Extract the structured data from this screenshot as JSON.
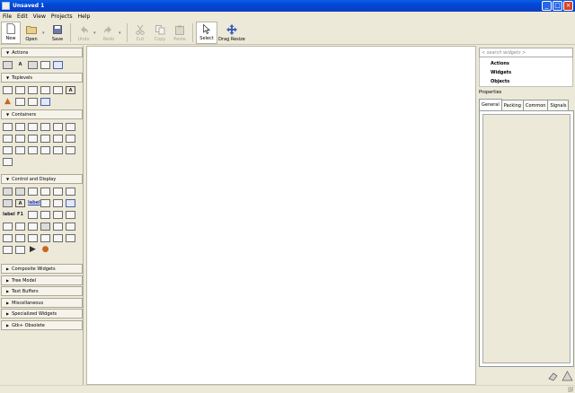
{
  "window": {
    "title": "Unsaved 1"
  },
  "menu": [
    "File",
    "Edit",
    "View",
    "Projects",
    "Help"
  ],
  "toolbar": {
    "new": "New",
    "open": "Open",
    "save": "Save",
    "undo": "Undo",
    "redo": "Redo",
    "cut": "Cut",
    "copy": "Copy",
    "paste": "Paste",
    "select": "Select",
    "drag_resize": "Drag Resize"
  },
  "palette": {
    "sections": {
      "actions": "Actions",
      "toplevels": "Toplevels",
      "containers": "Containers",
      "control": "Control and Display",
      "composite": "Composite Widgets",
      "tree": "Tree Model",
      "text": "Text Buffers",
      "misc": "Miscellaneous",
      "specialized": "Specialized Widgets",
      "obsolete": "Gtk+ Obsolete"
    },
    "glyphs": {
      "label_a": "A",
      "label_sample": "label",
      "link_sample": "label",
      "label_f1": "F1"
    }
  },
  "inspector": {
    "search_placeholder": "< search widgets >",
    "tree": [
      "Actions",
      "Widgets",
      "Objects"
    ],
    "properties_label": "Properties",
    "tabs": [
      "General",
      "Packing",
      "Common",
      "Signals"
    ]
  },
  "icons": {
    "new": "new-document-icon",
    "open": "open-folder-icon",
    "save": "save-disk-icon",
    "undo": "undo-arrow-icon",
    "redo": "redo-arrow-icon",
    "cut": "scissors-icon",
    "copy": "copy-icon",
    "paste": "paste-icon",
    "select": "pointer-icon",
    "drag_resize": "move-arrows-icon"
  },
  "colors": {
    "titlebar": "#0046d5",
    "chrome": "#ece9d8",
    "canvas": "#ffffff"
  }
}
